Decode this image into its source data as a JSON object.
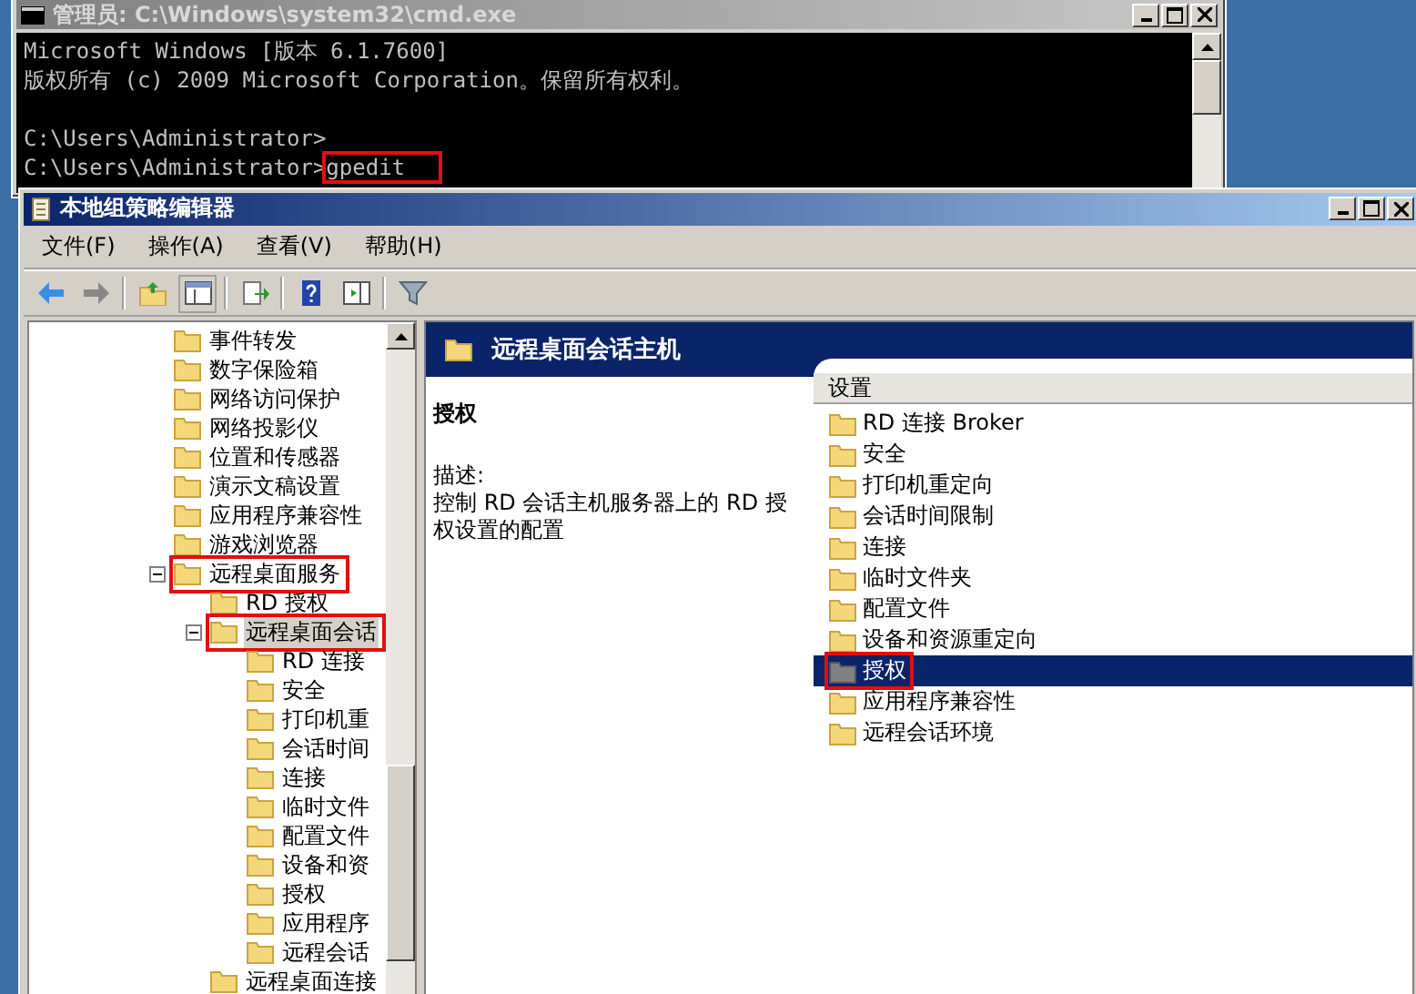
{
  "console": {
    "title": "管理员: C:\\Windows\\system32\\cmd.exe",
    "blocks": [
      [
        {
          "text": "Microsoft Windows [版本 6.1.7600]"
        },
        {
          "text": "版权所有 (c) 2009 Microsoft Corporation。保留所有权利。"
        }
      ],
      [
        {
          "text": "C:\\Users\\Administrator>"
        },
        {
          "text": "C:\\Users\\Administrator>",
          "command": "gpedit",
          "marked": true
        }
      ]
    ]
  },
  "editor": {
    "title": "本地组策略编辑器",
    "menu": [
      "文件(F)",
      "操作(A)",
      "查看(V)",
      "帮助(H)"
    ],
    "tree": [
      {
        "label": "事件转发",
        "selected": false,
        "marked": false
      },
      {
        "label": "数字保险箱",
        "selected": false,
        "marked": false
      },
      {
        "label": "网络访问保护",
        "selected": false,
        "marked": false
      },
      {
        "label": "网络投影仪",
        "selected": false,
        "marked": false
      },
      {
        "label": "位置和传感器",
        "selected": false,
        "marked": false
      },
      {
        "label": "演示文稿设置",
        "selected": false,
        "marked": false
      },
      {
        "label": "应用程序兼容性",
        "selected": false,
        "marked": false
      },
      {
        "label": "游戏浏览器",
        "selected": false,
        "marked": false
      },
      {
        "label": "远程桌面服务",
        "expanded": true,
        "selected": false,
        "marked": true,
        "children": [
          {
            "label": "RD 授权",
            "selected": false,
            "marked": false
          },
          {
            "label": "远程桌面会话",
            "expanded": true,
            "selected": true,
            "marked": true,
            "children": [
              {
                "label": "RD 连接",
                "selected": false,
                "marked": false
              },
              {
                "label": "安全",
                "selected": false,
                "marked": false
              },
              {
                "label": "打印机重",
                "selected": false,
                "marked": false
              },
              {
                "label": "会话时间",
                "selected": false,
                "marked": false
              },
              {
                "label": "连接",
                "selected": false,
                "marked": false
              },
              {
                "label": "临时文件",
                "selected": false,
                "marked": false
              },
              {
                "label": "配置文件",
                "selected": false,
                "marked": false
              },
              {
                "label": "设备和资",
                "selected": false,
                "marked": false
              },
              {
                "label": "授权",
                "selected": false,
                "marked": false
              },
              {
                "label": "应用程序",
                "selected": false,
                "marked": false
              },
              {
                "label": "远程会话",
                "selected": false,
                "marked": false
              }
            ]
          },
          {
            "label": "远程桌面连接",
            "selected": false,
            "marked": false
          }
        ]
      }
    ],
    "panel": {
      "heading": "远程桌面会话主机",
      "item_title": "授权",
      "description_label": "描述:",
      "description": "控制 RD 会话主机服务器上的 RD 授权设置的配置",
      "column": "设置",
      "settings": [
        {
          "label": "RD 连接 Broker",
          "selected": false,
          "marked": false
        },
        {
          "label": "安全",
          "selected": false,
          "marked": false
        },
        {
          "label": "打印机重定向",
          "selected": false,
          "marked": false
        },
        {
          "label": "会话时间限制",
          "selected": false,
          "marked": false
        },
        {
          "label": "连接",
          "selected": false,
          "marked": false
        },
        {
          "label": "临时文件夹",
          "selected": false,
          "marked": false
        },
        {
          "label": "配置文件",
          "selected": false,
          "marked": false
        },
        {
          "label": "设备和资源重定向",
          "selected": false,
          "marked": false
        },
        {
          "label": "授权",
          "selected": true,
          "marked": true
        },
        {
          "label": "应用程序兼容性",
          "selected": false,
          "marked": false
        },
        {
          "label": "远程会话环境",
          "selected": false,
          "marked": false
        }
      ]
    }
  }
}
